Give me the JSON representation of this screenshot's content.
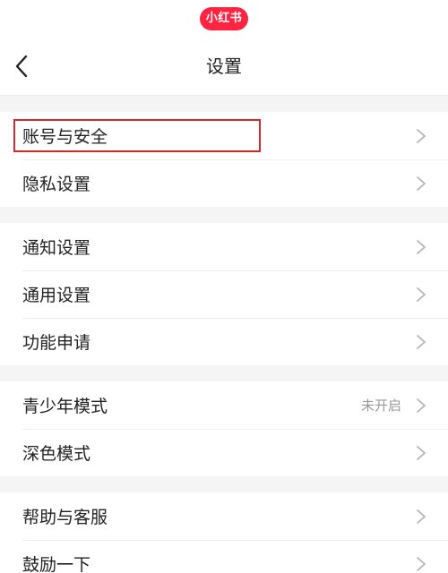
{
  "brand": {
    "logo_text": "小红书",
    "color": "#ff2442"
  },
  "navbar": {
    "back_icon": "chevron-left-icon",
    "title": "设置"
  },
  "groups": [
    {
      "items": [
        {
          "label": "账号与安全",
          "value": "",
          "highlighted": true
        },
        {
          "label": "隐私设置",
          "value": ""
        }
      ]
    },
    {
      "items": [
        {
          "label": "通知设置",
          "value": ""
        },
        {
          "label": "通用设置",
          "value": ""
        },
        {
          "label": "功能申请",
          "value": ""
        }
      ]
    },
    {
      "items": [
        {
          "label": "青少年模式",
          "value": "未开启"
        },
        {
          "label": "深色模式",
          "value": ""
        }
      ]
    },
    {
      "items": [
        {
          "label": "帮助与客服",
          "value": ""
        },
        {
          "label": "鼓励一下",
          "value": ""
        }
      ]
    }
  ],
  "colors": {
    "highlight_border": "#d42a2a",
    "chevron": "#b5b5b5"
  }
}
